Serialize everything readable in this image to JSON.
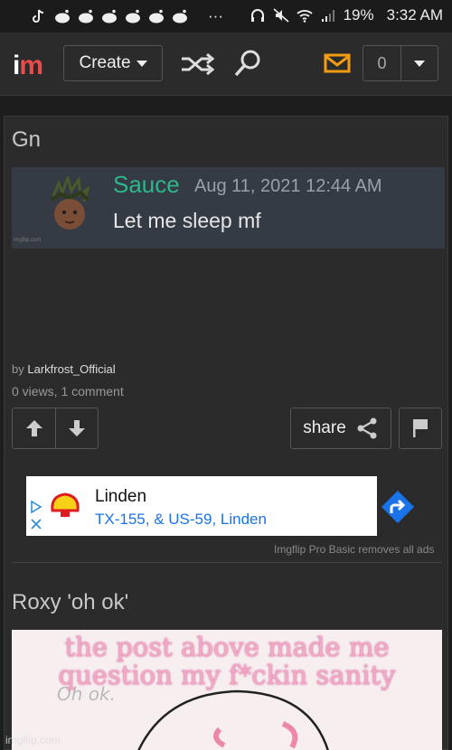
{
  "status_bar": {
    "battery": "19%",
    "time": "3:32 AM",
    "more": "···"
  },
  "header": {
    "logo_i": "i",
    "logo_m": "m",
    "create_label": "Create",
    "notification_count": "0"
  },
  "post1": {
    "title": "Gn",
    "image": {
      "username": "Sauce",
      "timestamp": "Aug 11, 2021 12:44 AM",
      "message": "Let me sleep mf",
      "watermark": "imgflip.com"
    },
    "by_prefix": "by",
    "author": "Larkfrost_Official",
    "stats": "0 views, 1 comment",
    "share_label": "share"
  },
  "ad": {
    "title": "Linden",
    "subtitle": "TX-155, & US-59, Linden",
    "note": "Imgflip Pro Basic removes all ads"
  },
  "post2": {
    "title": "Roxy 'oh ok'",
    "meme_text": "the post above made me question my f*ckin sanity",
    "doodle_text": "Oh ok."
  },
  "watermark": "imgflip.com",
  "colors": {
    "background": "#1d1d1d",
    "card": "#2b2b2b",
    "accent_orange": "#f39c12",
    "discord_name": "#2fb58a",
    "logo_red": "#e84c4c",
    "meme_pink": "#f4a8c8",
    "link_blue": "#1a73e8"
  }
}
